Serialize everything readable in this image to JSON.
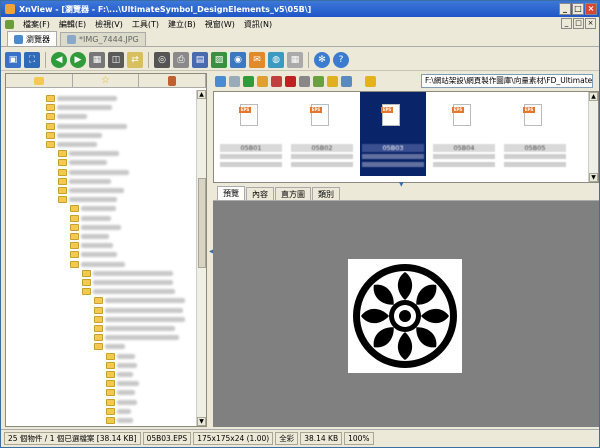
{
  "window": {
    "title": "XnView - [瀏覽器 - F:\\...\\UltimateSymbol_DesignElements_v5\\05B\\]",
    "min": "_",
    "max": "□",
    "close": "×"
  },
  "menu": [
    "檔案(F)",
    "編輯(E)",
    "檢視(V)",
    "工具(T)",
    "建立(B)",
    "視窗(W)",
    "資訊(N)"
  ],
  "mdi": [
    "_",
    "□",
    "×"
  ],
  "tabs": [
    {
      "label": "瀏覽器",
      "active": true
    },
    {
      "label": "*IMG_7444.JPG",
      "active": false
    }
  ],
  "path": "F:\\網站架設\\網頁製作圖庫\\向量素材\\FD_UltimateS",
  "thumbnails": [
    {
      "label": "05B01",
      "selected": false
    },
    {
      "label": "05B02",
      "selected": false
    },
    {
      "label": "05B03",
      "selected": true
    },
    {
      "label": "05B04",
      "selected": false
    },
    {
      "label": "05B05",
      "selected": false
    }
  ],
  "file_badge": "EPS",
  "preview_tabs": [
    "預覽",
    "內容",
    "直方圖",
    "類別"
  ],
  "status": {
    "objects": "25 個物件 / 1 個已選檔案 [38.14 KB]",
    "file": "05B03.EPS",
    "dims": "175x175x24 (1.00)",
    "color": "全彩",
    "size": "38.14 KB",
    "zoom": "100%"
  },
  "colors": {
    "title": "#1f55c8",
    "selection": "#0a246a",
    "preview_bg": "#808080",
    "folder": "#f3c94f"
  }
}
